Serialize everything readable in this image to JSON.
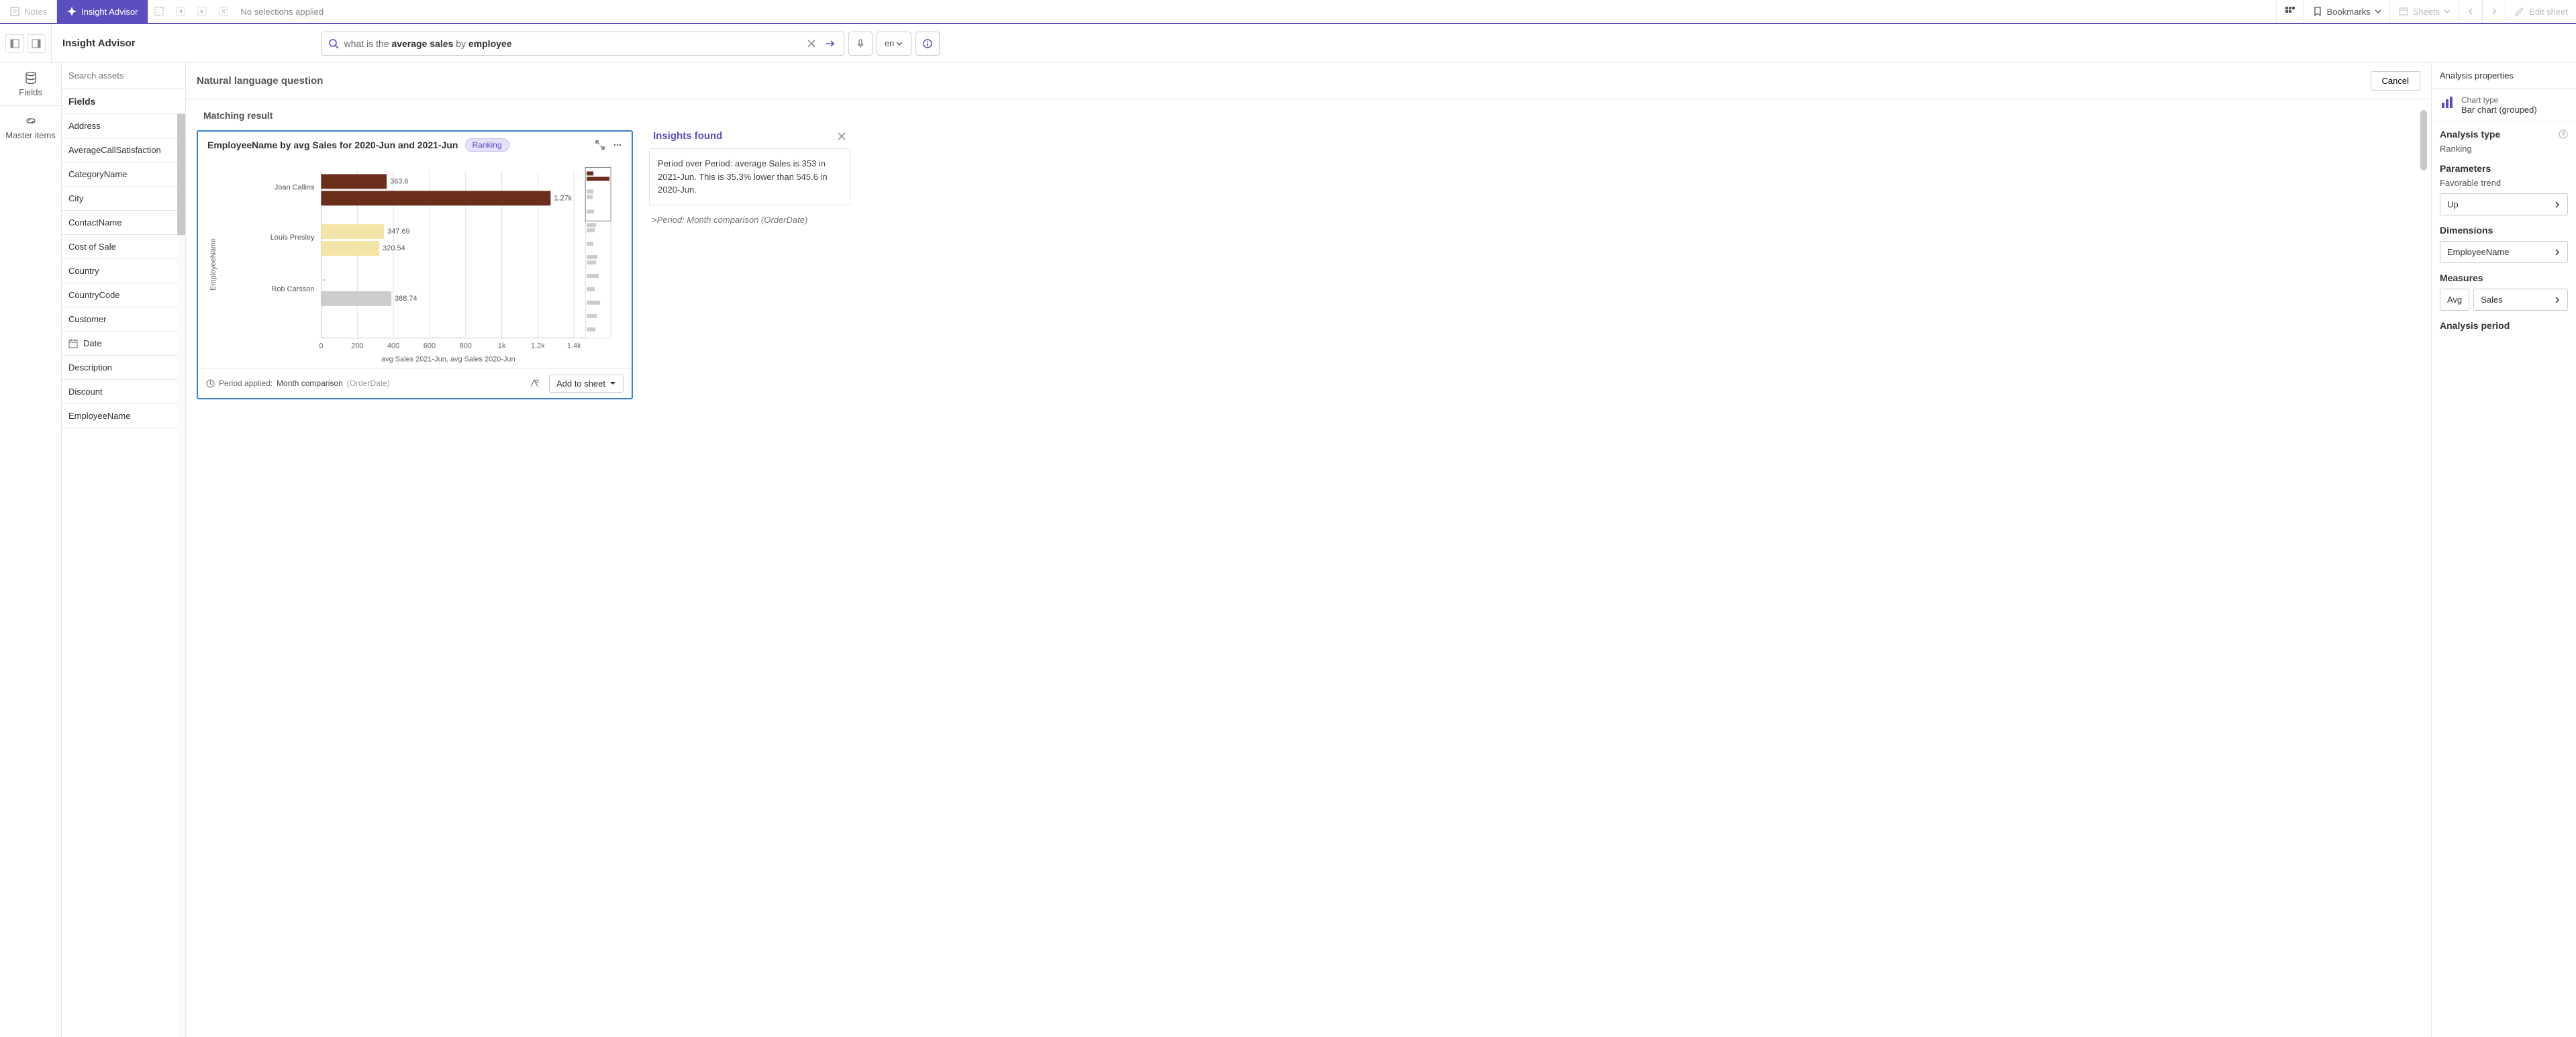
{
  "toolbar": {
    "notes": "Notes",
    "insight_advisor": "Insight Advisor",
    "no_selections": "No selections applied",
    "bookmarks": "Bookmarks",
    "sheets": "Sheets",
    "edit_sheet": "Edit sheet"
  },
  "secbar": {
    "title": "Insight Advisor",
    "search_prefix1": "what is the ",
    "search_strong1": "average sales",
    "search_prefix2": " by ",
    "search_strong2": "employee",
    "search_full": "what is the average sales by employee",
    "lang": "en"
  },
  "rail": {
    "fields": "Fields",
    "master_items": "Master items"
  },
  "assets": {
    "search_placeholder": "Search assets",
    "header": "Fields",
    "items": [
      {
        "label": "Address",
        "icon": ""
      },
      {
        "label": "AverageCallSatisfaction",
        "icon": ""
      },
      {
        "label": "CategoryName",
        "icon": ""
      },
      {
        "label": "City",
        "icon": ""
      },
      {
        "label": "ContactName",
        "icon": ""
      },
      {
        "label": "Cost of Sale",
        "icon": ""
      },
      {
        "label": "Country",
        "icon": ""
      },
      {
        "label": "CountryCode",
        "icon": ""
      },
      {
        "label": "Customer",
        "icon": ""
      },
      {
        "label": "Date",
        "icon": "cal"
      },
      {
        "label": "Description",
        "icon": ""
      },
      {
        "label": "Discount",
        "icon": ""
      },
      {
        "label": "EmployeeName",
        "icon": ""
      }
    ]
  },
  "center": {
    "nlq_title": "Natural language question",
    "cancel": "Cancel",
    "matching": "Matching result",
    "chart_title": "EmployeeName by avg Sales for 2020-Jun and 2021-Jun",
    "badge": "Ranking",
    "period_prefix": "Period applied:",
    "period_label": "Month comparison",
    "period_sub": "(OrderDate)",
    "add_to_sheet": "Add to sheet"
  },
  "chart_data": {
    "type": "bar",
    "orientation": "horizontal",
    "grouped": true,
    "ylabel": "EmployeeName",
    "xlabel": "avg Sales 2021-Jun, avg Sales 2020-Jun",
    "xlim": [
      0,
      1400
    ],
    "xticks": [
      0,
      200,
      400,
      600,
      800,
      "1k",
      "1.2k",
      "1.4k"
    ],
    "categories": [
      "Joan Callins",
      "Louis Presley",
      "Rob Carsson"
    ],
    "series": [
      {
        "name": "avg Sales 2021-Jun",
        "values": [
          363.6,
          347.69,
          null
        ],
        "labels": [
          "363.6",
          "347.69",
          "-"
        ]
      },
      {
        "name": "avg Sales 2020-Jun",
        "values": [
          1270,
          320.54,
          388.74
        ],
        "labels": [
          "1.27k",
          "320.54",
          "388.74"
        ]
      }
    ],
    "colors": {
      "Joan Callins": "#6B2E1A",
      "Louis Presley": "#F3E5A8",
      "Rob Carsson": "#CCCCCC"
    }
  },
  "insights": {
    "title": "Insights found",
    "body": "Period over Period: average Sales is 353 in 2021-Jun. This is 35.3% lower than 545.6 in 2020-Jun.",
    "sub_prefix": ">",
    "sub": "Period: Month comparison (OrderDate)"
  },
  "props": {
    "header": "Analysis properties",
    "chart_type_label": "Chart type",
    "chart_type_value": "Bar chart (grouped)",
    "analysis_type_label": "Analysis type",
    "analysis_type_value": "Ranking",
    "parameters_label": "Parameters",
    "fav_trend_label": "Favorable trend",
    "fav_trend_value": "Up",
    "dimensions_label": "Dimensions",
    "dimension_value": "EmployeeName",
    "measures_label": "Measures",
    "measure_agg": "Avg",
    "measure_value": "Sales",
    "analysis_period_label": "Analysis period"
  }
}
